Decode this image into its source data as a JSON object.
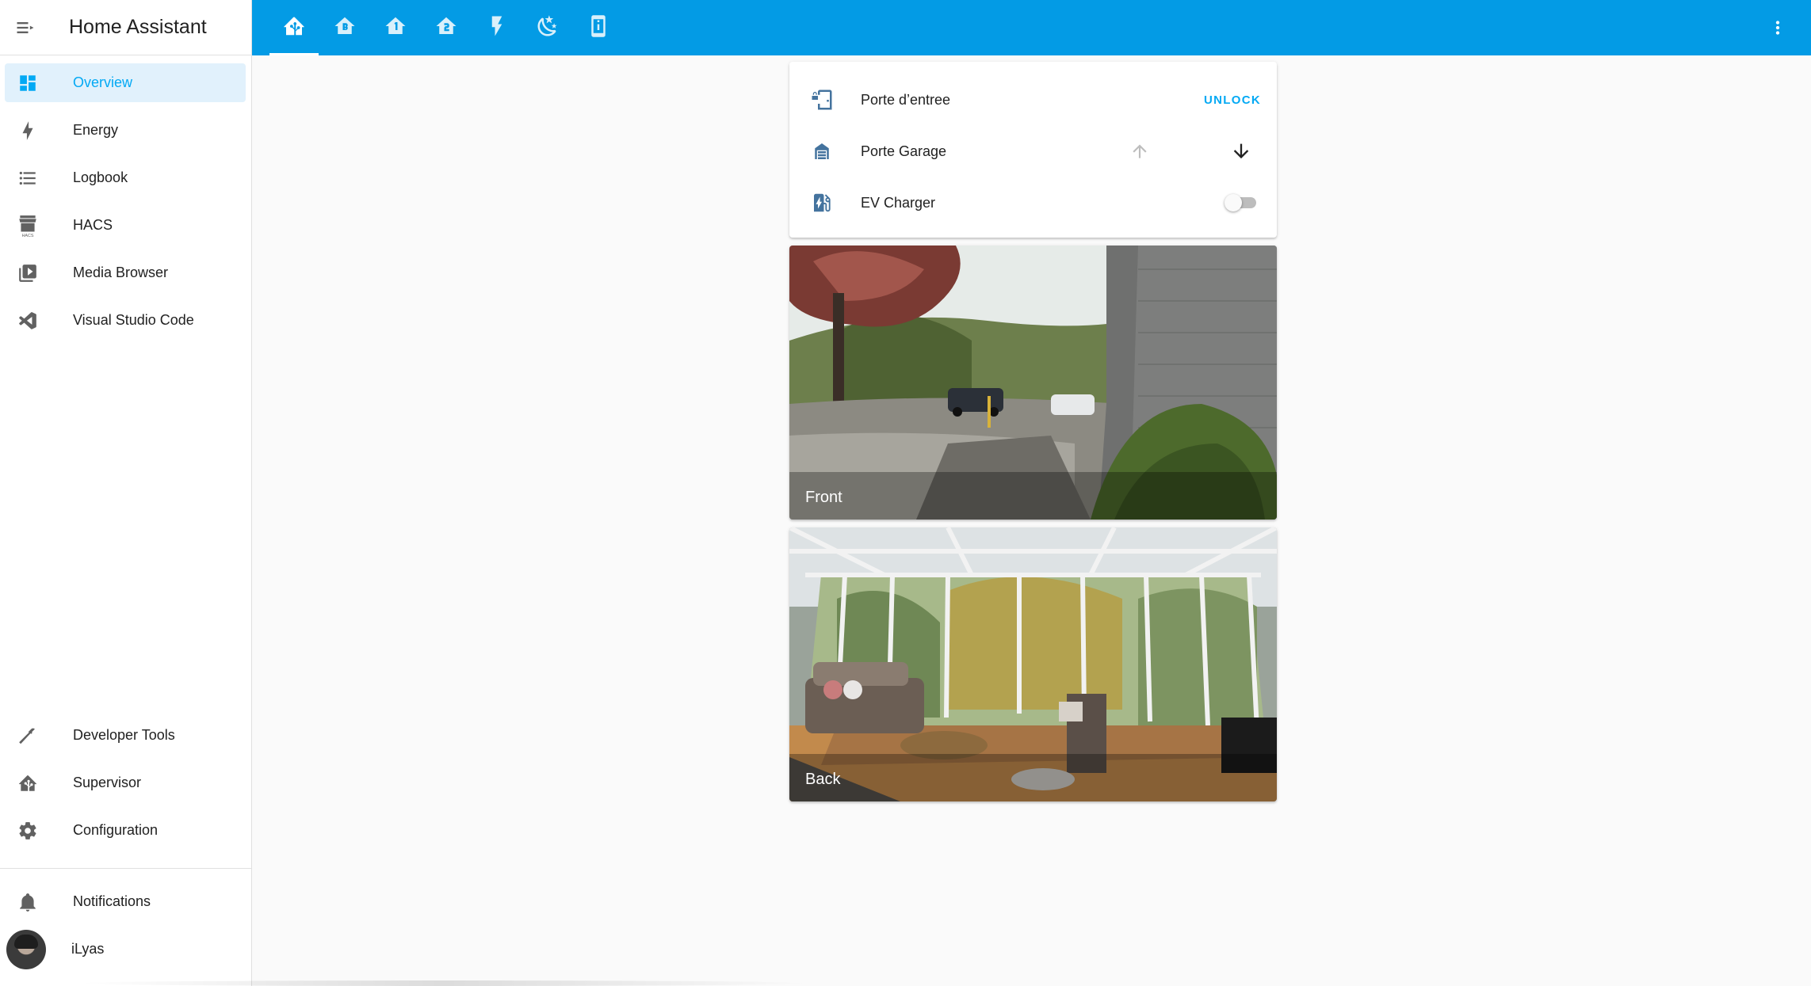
{
  "app": {
    "title": "Home Assistant"
  },
  "sidebar": {
    "items": [
      {
        "label": "Overview",
        "icon": "view-dashboard-icon",
        "active": true
      },
      {
        "label": "Energy",
        "icon": "lightning-bolt-icon"
      },
      {
        "label": "Logbook",
        "icon": "format-list-bulleted-icon"
      },
      {
        "label": "HACS",
        "icon": "hacs-store-icon"
      },
      {
        "label": "Media Browser",
        "icon": "play-box-multiple-icon"
      },
      {
        "label": "Visual Studio Code",
        "icon": "vscode-icon"
      },
      {
        "label": "Developer Tools",
        "icon": "hammer-icon"
      },
      {
        "label": "Supervisor",
        "icon": "home-assistant-icon"
      },
      {
        "label": "Configuration",
        "icon": "cog-icon"
      },
      {
        "label": "Notifications",
        "icon": "bell-icon"
      },
      {
        "label": "iLyas",
        "icon": "avatar"
      }
    ]
  },
  "topbar": {
    "tabs": [
      {
        "icon": "home-assistant-icon",
        "active": true
      },
      {
        "icon": "home-floor-b-icon"
      },
      {
        "icon": "home-floor-1-icon"
      },
      {
        "icon": "home-floor-2-icon"
      },
      {
        "icon": "flash-icon"
      },
      {
        "icon": "weather-night-icon"
      },
      {
        "icon": "cellphone-information-icon"
      }
    ],
    "accent": "#039be5"
  },
  "entities": {
    "rows": [
      {
        "name": "Porte d’entree",
        "icon": "door-lock-icon",
        "action": "UNLOCK"
      },
      {
        "name": "Porte Garage",
        "icon": "garage-icon"
      },
      {
        "name": "EV Charger",
        "icon": "ev-station-icon",
        "toggle_on": false
      }
    ]
  },
  "cameras": [
    {
      "caption": "Front"
    },
    {
      "caption": "Back"
    }
  ]
}
